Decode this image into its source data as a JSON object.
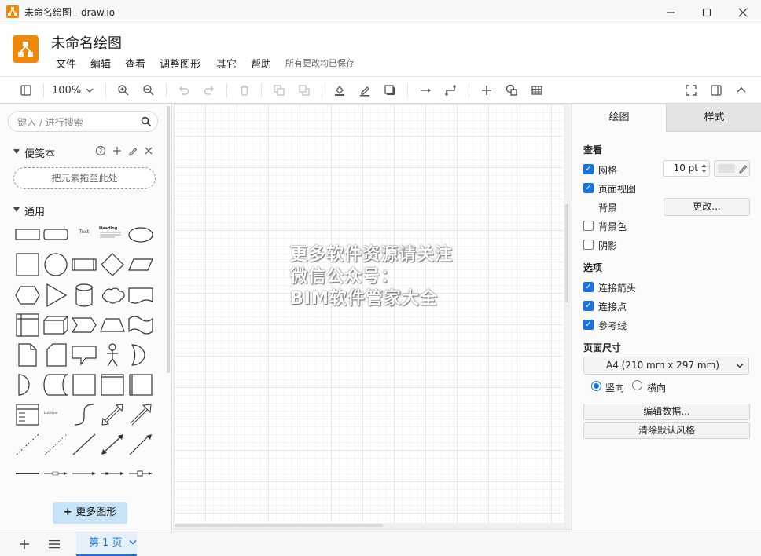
{
  "window": {
    "title": "未命名绘图 - draw.io",
    "minimize": "—",
    "maximize": "☐",
    "close": "✕"
  },
  "header": {
    "doc_title": "未命名绘图",
    "menus": [
      "文件",
      "编辑",
      "查看",
      "调整图形",
      "其它",
      "帮助"
    ],
    "save_status": "所有更改均已保存"
  },
  "toolbar": {
    "zoom": "100%",
    "icons": [
      "format-panel-icon",
      "zoom-in-icon",
      "zoom-out-icon",
      "undo-icon",
      "redo-icon",
      "delete-icon",
      "to-front-icon",
      "to-back-icon",
      "fill-color-icon",
      "line-color-icon",
      "shadow-icon",
      "connection-icon",
      "waypoints-icon",
      "insert-icon",
      "shapes-icon",
      "table-icon",
      "fullscreen-icon",
      "format-toggle-icon",
      "collapse-icon"
    ]
  },
  "left_panel": {
    "search_placeholder": "键入 / 进行搜索",
    "scratchpad_title": "便笺本",
    "dropzone": "把元素拖至此处",
    "general_title": "通用",
    "text_shape": "Text",
    "heading_shape": "Heading",
    "textbox_shape": "List Item",
    "more_shapes": "更多图形"
  },
  "canvas": {
    "watermark_lines": [
      "更多软件资源请关注",
      "微信公众号：",
      "BIM软件管家大全"
    ]
  },
  "right_panel": {
    "tabs": [
      "绘图",
      "样式"
    ],
    "view_title": "查看",
    "grid_label": "网格",
    "grid_checked": true,
    "grid_size": "10 pt",
    "pageview_label": "页面视图",
    "pageview_checked": true,
    "background_label": "背景",
    "change_button": "更改...",
    "bgcolor_label": "背景色",
    "bgcolor_checked": false,
    "shadow_label": "阴影",
    "shadow_checked": false,
    "options_title": "选项",
    "connection_arrows_label": "连接箭头",
    "connection_arrows_checked": true,
    "connection_points_label": "连接点",
    "connection_points_checked": true,
    "guides_label": "参考线",
    "guides_checked": true,
    "page_size_title": "页面尺寸",
    "page_size_value": "A4 (210 mm x 297 mm)",
    "portrait_label": "竖向",
    "landscape_label": "横向",
    "orientation": "portrait",
    "edit_data_button": "编辑数据...",
    "clear_style_button": "清除默认风格"
  },
  "bottom": {
    "add": "+",
    "menu": "≡",
    "page_tab": "第 1 页"
  },
  "colors": {
    "accent": "#1473e6",
    "brand": "#f08705"
  }
}
